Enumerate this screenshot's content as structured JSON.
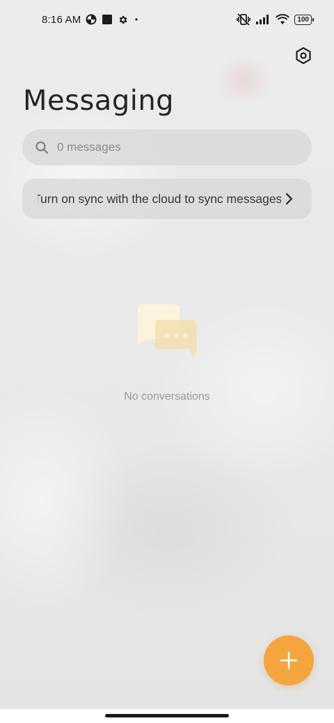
{
  "status_bar": {
    "time": "8:16 AM",
    "battery": "100",
    "left_icons": [
      "data-saver-icon",
      "stop-square-icon",
      "gear-icon",
      "dot-icon"
    ],
    "right_icons": [
      "vibrate-off-icon",
      "signal-icon",
      "wifi-icon",
      "battery-icon"
    ]
  },
  "header": {
    "title": "Messaging",
    "settings_icon": "settings-hexagon-icon"
  },
  "search": {
    "placeholder": "0 messages"
  },
  "sync_banner": {
    "text": "Turn on sync with the cloud to sync messages"
  },
  "empty_state": {
    "text": "No conversations",
    "icon": "chat-bubbles-icon"
  },
  "fab": {
    "icon": "plus-icon",
    "color": "#f5a53e"
  }
}
